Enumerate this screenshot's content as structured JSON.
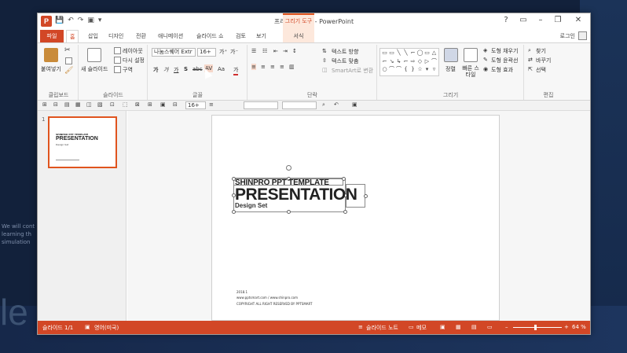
{
  "window": {
    "title": "프레젠테이션3 - PowerPoint",
    "app_badge": "P",
    "context_tab_header": "그리기 도구",
    "signin": "로그인"
  },
  "qat": [
    "💾",
    "↶",
    "↷",
    "▣",
    "▾"
  ],
  "win_controls": [
    "?",
    "▭",
    "–",
    "❐",
    "✕"
  ],
  "tabs": [
    "파일",
    "홈",
    "삽입",
    "디자인",
    "전환",
    "애니메이션",
    "슬라이드 쇼",
    "검토",
    "보기",
    "서식"
  ],
  "ribbon": {
    "clipboard": {
      "label": "클립보드",
      "paste": "붙여넣기"
    },
    "slides": {
      "label": "슬라이드",
      "new_slide": "새 슬라이드",
      "layout": "레이아웃",
      "reset": "다시 설정",
      "section": "구역"
    },
    "font": {
      "label": "글꼴",
      "name": "나눔스퀘어 Extr",
      "size": "16+",
      "bold": "가",
      "italic": "가",
      "underline": "가",
      "shadow": "S",
      "strike": "abc",
      "spacing": "AV",
      "case": "Aa",
      "color": "가"
    },
    "paragraph": {
      "label": "단락",
      "text_direction": "텍스트 방향",
      "align_text": "텍스트 맞춤",
      "smartart": "SmartArt로 변환"
    },
    "drawing": {
      "label": "그리기",
      "arrange": "정렬",
      "quick_styles": "빠른 스타일",
      "fill": "도형 채우기",
      "outline": "도형 윤곽선",
      "effects": "도형 효과"
    },
    "editing": {
      "label": "편집",
      "find": "찾기",
      "replace": "바꾸기",
      "select": "선택"
    }
  },
  "toolbar2": {
    "font_size": "16+"
  },
  "thumbnail": {
    "number": "1",
    "sub": "SHINPRO PPT TEMPLATE",
    "title": "PRESENTATION",
    "design": "Design Set"
  },
  "slide": {
    "sub": "SHINPRO PPT TEMPLATE",
    "title": "PRESENTATION",
    "design": "Design Set",
    "footer1": "2018.1",
    "footer2": "www.pptsmart.com / www.shinpro.com",
    "footer3": "COPYRIGHT  ALL RIGHT RESERVED BY PPTSMART"
  },
  "statusbar": {
    "slide_count": "슬라이드 1/1",
    "language": "영어(미국)",
    "notes": "슬라이드 노트",
    "comments": "메모",
    "zoom": "64 %"
  },
  "background": {
    "text_lines": [
      "We will cont",
      "learning th",
      "simulation"
    ],
    "big_letter": "le"
  },
  "colors": {
    "accent": "#d24726",
    "background": "#12213b"
  }
}
